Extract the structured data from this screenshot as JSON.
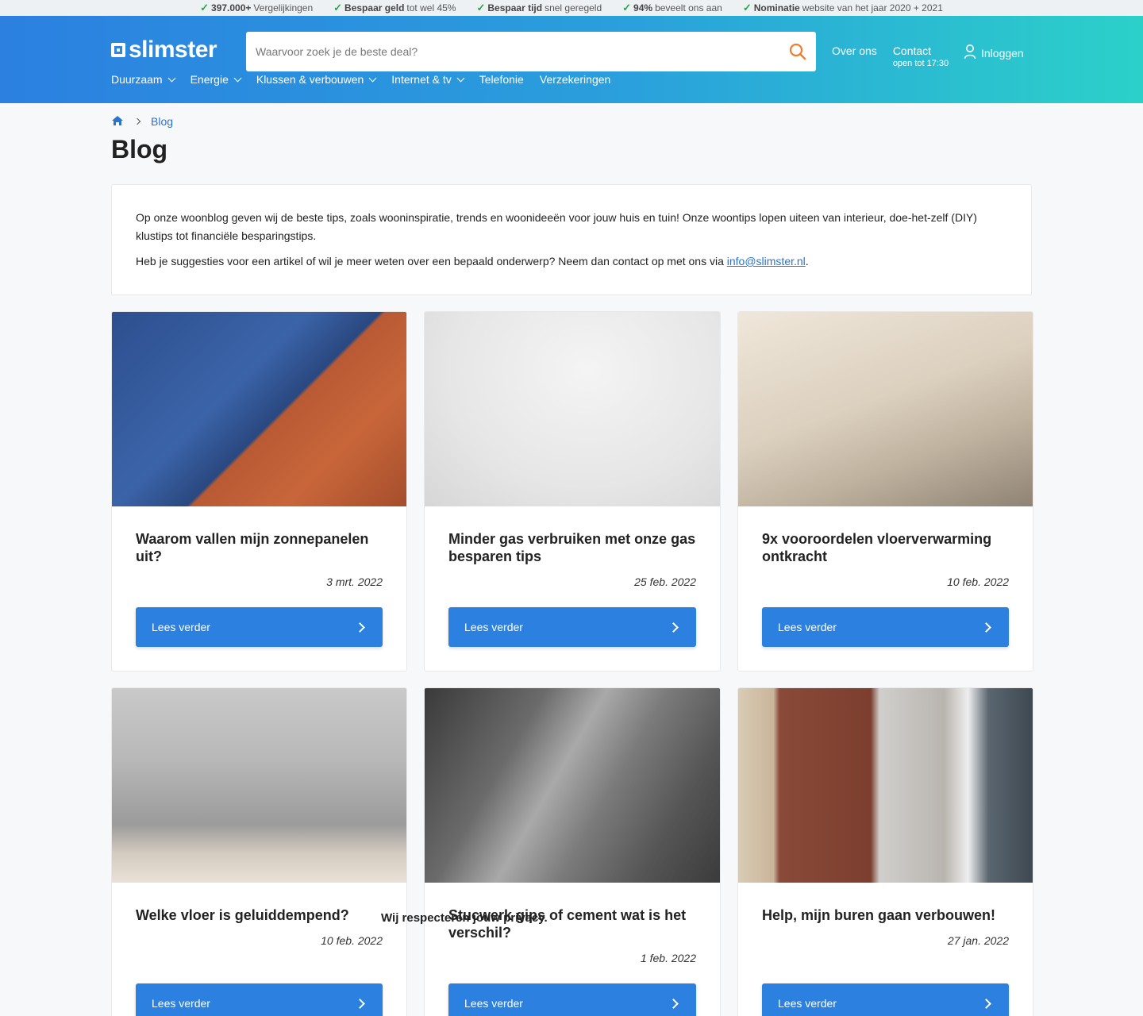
{
  "usp": [
    {
      "bold": "397.000+",
      "text": "Vergelijkingen"
    },
    {
      "bold": "Bespaar geld",
      "text": "tot wel 45%"
    },
    {
      "bold": "Bespaar tijd",
      "text": "snel geregeld"
    },
    {
      "bold": "94%",
      "text": "beveelt ons aan"
    },
    {
      "bold": "Nominatie",
      "text": "website van het jaar 2020 + 2021"
    }
  ],
  "header": {
    "logo": "slimster",
    "search_placeholder": "Waarvoor zoek je de beste deal?",
    "over_ons": "Over ons",
    "contact": "Contact",
    "contact_hours": "open tot 17:30",
    "login": "Inloggen",
    "nav": [
      "Duurzaam",
      "Energie",
      "Klussen & verbouwen",
      "Internet & tv",
      "Telefonie",
      "Verzekeringen"
    ]
  },
  "breadcrumb": {
    "current": "Blog"
  },
  "page_title": "Blog",
  "intro": {
    "p1": "Op onze woonblog geven wij de beste tips, zoals wooninspiratie, trends en woonideeën voor jouw huis en tuin! Onze woontips lopen uiteen van interieur, doe-het-zelf (DIY) klustips tot financiële besparingstips.",
    "p2_before": "Heb je suggesties voor een artikel of wil je meer weten over een bepaald onderwerp? Neem dan contact op met ons via ",
    "p2_link": "info@slimster.nl",
    "p2_after": "."
  },
  "cards": [
    {
      "title": "Waarom vallen mijn zonnepanelen uit?",
      "date": "3 mrt. 2022",
      "button": "Lees verder"
    },
    {
      "title": "Minder gas verbruiken met onze gas besparen tips",
      "date": "25 feb. 2022",
      "button": "Lees verder"
    },
    {
      "title": "9x vooroordelen vloerverwarming ontkracht",
      "date": "10 feb. 2022",
      "button": "Lees verder"
    },
    {
      "title": "Welke vloer is geluiddempend?",
      "date": "10 feb. 2022",
      "button": "Lees verder"
    },
    {
      "title": "Stucwerk gips of cement wat is het verschil?",
      "date": "1 feb. 2022",
      "button": "Lees verder"
    },
    {
      "title": "Help, mijn buren gaan verbouwen!",
      "date": "27 jan. 2022",
      "button": "Lees verder"
    }
  ],
  "privacy_text": "Wij respecteren jouw privacy."
}
